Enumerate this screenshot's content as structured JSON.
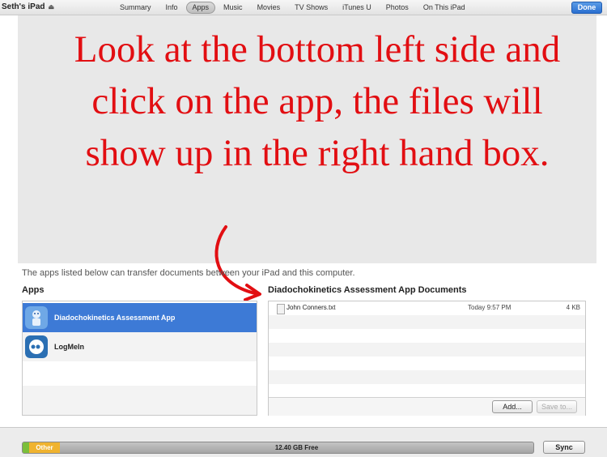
{
  "topbar": {
    "device_name": "Seth's iPad",
    "tabs": [
      "Summary",
      "Info",
      "Apps",
      "Music",
      "Movies",
      "TV Shows",
      "iTunes U",
      "Photos",
      "On This iPad"
    ],
    "active_tab": "Apps",
    "done_label": "Done"
  },
  "instruction": {
    "text": "Look at the bottom left side and click on the app, the files will show up in the right hand box."
  },
  "file_sharing": {
    "description": "The apps listed below can transfer documents between your iPad and this computer.",
    "apps_heading": "Apps",
    "apps": [
      {
        "name": "Diadochokinetics Assessment App",
        "selected": true
      },
      {
        "name": "LogMeIn",
        "selected": false
      }
    ],
    "documents_heading": "Diadochokinetics Assessment App Documents",
    "documents": [
      {
        "name": "John Conners.txt",
        "date": "Today 9:57 PM",
        "size": "4 KB"
      }
    ],
    "add_label": "Add...",
    "save_label": "Save to..."
  },
  "capacity": {
    "other_label": "Other",
    "free_label": "12.40 GB Free",
    "sync_label": "Sync"
  },
  "colors": {
    "instruction_red": "#e20e12",
    "selection_blue": "#3d7ad6",
    "other_yellow": "#f0b32f"
  }
}
